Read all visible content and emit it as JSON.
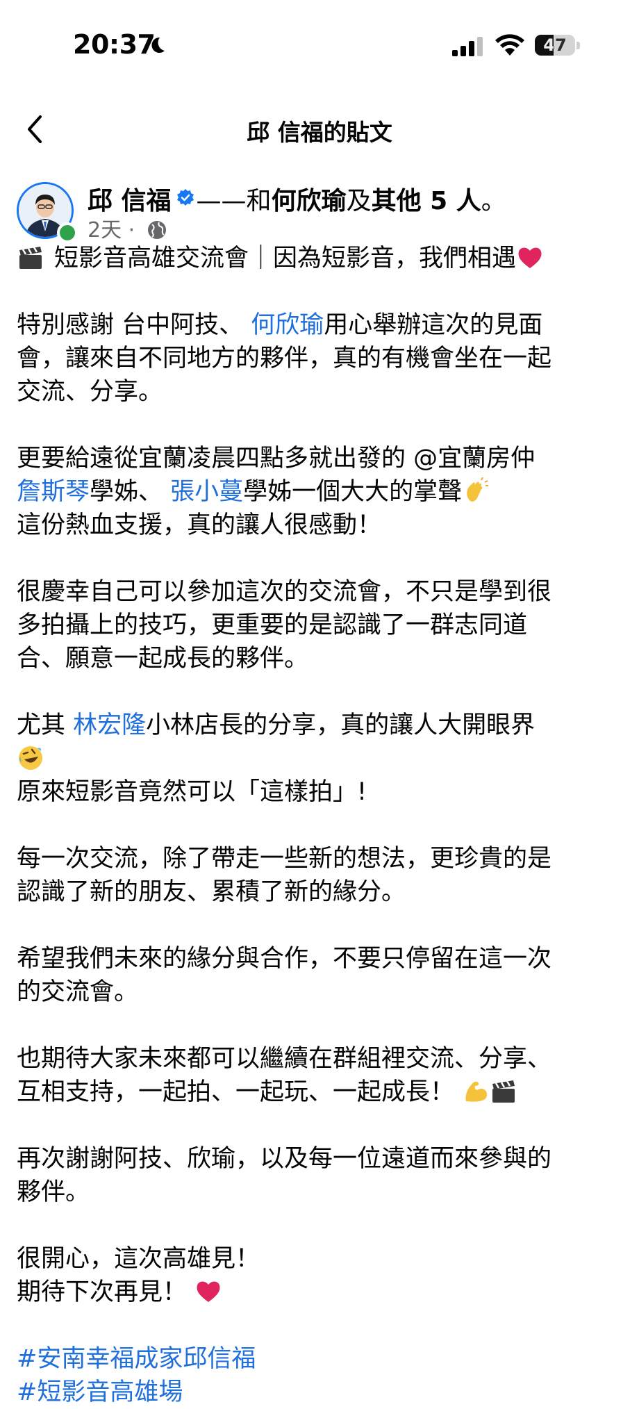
{
  "status_bar": {
    "time": "20:37",
    "battery_level": "47",
    "icons": [
      "moon-icon",
      "signal-bars-icon",
      "wifi-icon",
      "battery-icon"
    ]
  },
  "nav": {
    "title": "邱 信福的貼文",
    "back_icon": "chevron-left-icon"
  },
  "post": {
    "author": "邱 信福",
    "with_prefix": "——和",
    "with_person": "何欣瑜",
    "with_suffix": "及",
    "with_others": "其他 5 人",
    "with_end": "。",
    "time_ago": "2天",
    "separator": " · ",
    "privacy_icon": "globe-icon",
    "body": {
      "intro": "短影音高雄交流會｜因為短影音，我們相遇",
      "p1_l1_a": "特別感謝 台中阿技、  ",
      "p1_l1_mention": "何欣瑜",
      "p1_l1_b": "用心舉辦這次的見面",
      "p1_l2": "會，讓來自不同地方的夥伴，真的有機會坐在一起",
      "p1_l3": "交流、分享。",
      "p2_l1": "更要給遠從宜蘭凌晨四點多就出發的 @宜蘭房仲",
      "p2_l2_mention1": "詹斯琴",
      "p2_l2_a": "學姊、  ",
      "p2_l2_mention2": "張小蔓",
      "p2_l2_b": "學姊一個大大的掌聲",
      "p2_l3": "這份熱血支援，真的讓人很感動！",
      "p3_l1": "很慶幸自己可以參加這次的交流會，不只是學到很",
      "p3_l2": "多拍攝上的技巧，更重要的是認識了一群志同道",
      "p3_l3": "合、願意一起成長的夥伴。",
      "p4_l1_a": "尤其  ",
      "p4_l1_mention": "林宏隆",
      "p4_l1_b": "小林店長的分享，真的讓人大開眼界",
      "p4_l3": "原來短影音竟然可以「這樣拍」!",
      "p5_l1": "每一次交流，除了帶走一些新的想法，更珍貴的是",
      "p5_l2": "認識了新的朋友、累積了新的緣分。",
      "p6_l1": "希望我們未來的緣分與合作，不要只停留在這一次",
      "p6_l2": "的交流會。",
      "p7_l1": "也期待大家未來都可以繼續在群組裡交流、分享、",
      "p7_l2": "互相支持，一起拍、一起玩、一起成長！ ",
      "p8_l1": "再次謝謝阿技、欣瑜，以及每一位遠道而來參與的",
      "p8_l2": "夥伴。",
      "p9_l1": "很開心，這次高雄見！",
      "p9_l2": "期待下次再見！ ",
      "hashtag1": "#安南幸福成家邱信福",
      "hashtag2": "#短影音高雄場"
    },
    "emoji_names": [
      "clapper-board-emoji",
      "red-heart-emoji",
      "clapping-hands-emoji",
      "rolling-laughing-emoji",
      "flexed-biceps-emoji"
    ]
  },
  "colors": {
    "link": "#216fdb",
    "verified": "#1877f2",
    "online": "#31a24c",
    "meta_text": "#65676b",
    "heart": "#e0245e"
  }
}
